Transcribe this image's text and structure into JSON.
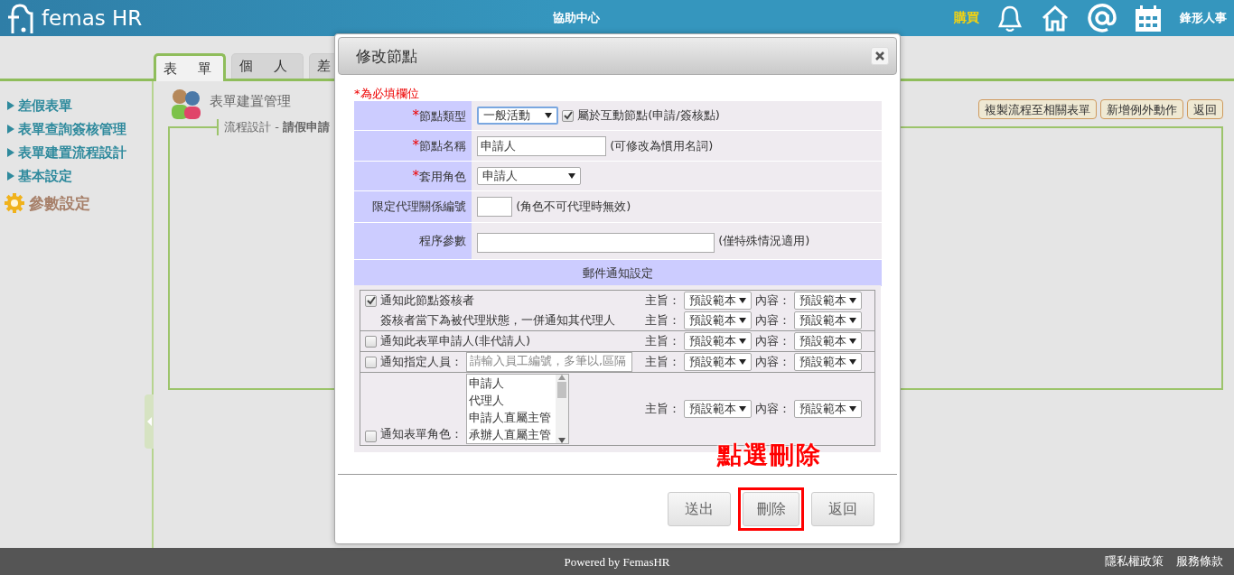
{
  "header": {
    "logo_text": "femas HR",
    "center_link": "協助中心",
    "buy_link": "購買",
    "company": "鋒形人事"
  },
  "tabs": [
    {
      "label": "表單",
      "selected": true
    },
    {
      "label": "個人",
      "selected": false
    },
    {
      "label": "差",
      "selected": false
    }
  ],
  "sidebar": {
    "items": [
      {
        "kind": "link",
        "label": "差假表單"
      },
      {
        "kind": "link",
        "label": "表單查詢簽核管理"
      },
      {
        "kind": "link",
        "label": "表單建置流程設計"
      },
      {
        "kind": "link",
        "label": "基本設定"
      },
      {
        "kind": "gear",
        "label": "參數設定"
      }
    ]
  },
  "content": {
    "title": "表單建置管理",
    "buttons": [
      "複製流程至相關表單",
      "新增例外動作",
      "返回"
    ],
    "legend": "流程設計 - **請假申請**"
  },
  "dialog": {
    "title": "修改節點",
    "required_note": "*為必填欄位",
    "rows": [
      {
        "kind": "select",
        "mark": "*",
        "label": "節點類型",
        "value": "一般活動",
        "focused": true,
        "checkbox": {
          "label": "屬於互動節點(申請/簽核點)",
          "checked": true
        }
      },
      {
        "kind": "text",
        "mark": "*",
        "label": "節點名稱",
        "value": "申請人",
        "note": "(可修改為慣用名詞)"
      },
      {
        "kind": "select",
        "mark": "*",
        "label": "套用角色",
        "value": "申請人",
        "focused": false
      },
      {
        "kind": "short",
        "label": "限定代理關係編號",
        "note": "(角色不可代理時無效)"
      },
      {
        "kind": "textarea",
        "label": "程序參數",
        "note": "(僅特殊情況適用)"
      }
    ],
    "mail_title": "郵件通知設定",
    "mail_groups": [
      {
        "lines": [
          {
            "kind": "checkbox",
            "checked": true,
            "label": "通知此節點簽核者",
            "subject_label": "主旨：",
            "subject": "預設範本",
            "content_label": "內容：",
            "content": "預設範本"
          },
          {
            "kind": "note",
            "label": "簽核者當下為被代理狀態，一併通知其代理人",
            "subject_label": "主旨：",
            "subject": "預設範本",
            "content_label": "內容：",
            "content": "預設範本"
          }
        ]
      },
      {
        "lines": [
          {
            "kind": "checkbox",
            "checked": false,
            "label": "通知此表單申請人(非代請人)",
            "subject_label": "主旨：",
            "subject": "預設範本",
            "content_label": "內容：",
            "content": "預設範本"
          }
        ]
      },
      {
        "lines": [
          {
            "kind": "checkbox",
            "checked": false,
            "label": "通知指定人員：",
            "placeholder": "請輸入員工編號，多筆以,區隔",
            "subject_label": "主旨：",
            "subject": "預設範本",
            "content_label": "內容：",
            "content": "預設範本"
          }
        ]
      },
      {
        "lines": [
          {
            "kind": "checkbox",
            "checked": false,
            "label": "通知表單角色：",
            "options": [
              "申請人",
              "代理人",
              "申請人直屬主管",
              "承辦人直屬主管"
            ],
            "subject_label": "主旨：",
            "subject": "預設範本",
            "content_label": "內容：",
            "content": "預設範本"
          }
        ]
      }
    ],
    "buttons": [
      {
        "label": "送出",
        "highlighted": false
      },
      {
        "label": "刪除",
        "highlighted": true
      },
      {
        "label": "返回",
        "highlighted": false
      }
    ],
    "annotation": "點選刪除"
  },
  "footer": {
    "powered": "Powered by ",
    "powered_link": "FemasHR",
    "links": [
      "隱私權政策",
      "服務條款"
    ]
  }
}
